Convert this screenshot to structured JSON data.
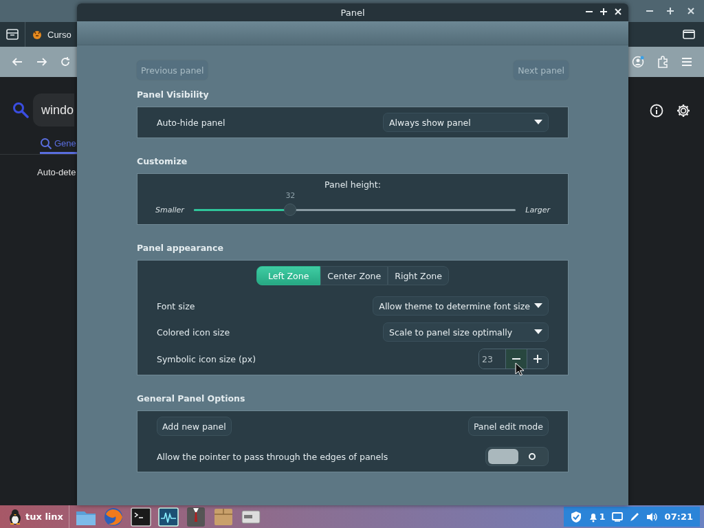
{
  "browser": {
    "tab_label": "Curso",
    "search": {
      "value": "windo"
    },
    "tabs": [
      {
        "label": "Gene",
        "selected": true
      }
    ],
    "setting_label": "Auto-dete"
  },
  "dialog": {
    "title": "Panel",
    "nav": [
      {
        "label": "Previous panel",
        "disabled": true
      },
      {
        "label": "Next panel",
        "disabled": true
      }
    ],
    "sections": [
      {
        "title": "Panel Visibility",
        "rows": [
          {
            "kind": "dropdown",
            "label": "Auto-hide panel",
            "value": "Always show panel"
          }
        ]
      },
      {
        "title": "Customize",
        "rows": [
          {
            "kind": "slider",
            "label": "Panel height:",
            "min_label": "Smaller",
            "max_label": "Larger",
            "reading": "32",
            "level": 0.3
          }
        ]
      },
      {
        "title": "Panel appearance",
        "rows": [
          {
            "kind": "zones",
            "zones": [
              {
                "label": "Left Zone",
                "selected": true
              },
              {
                "label": "Center Zone",
                "selected": false
              },
              {
                "label": "Right Zone",
                "selected": false
              }
            ]
          },
          {
            "kind": "dropdown",
            "label": "Font size",
            "value": "Allow theme to determine font size"
          },
          {
            "kind": "dropdown",
            "label": "Colored icon size",
            "value": "Scale to panel size optimally"
          },
          {
            "kind": "spin",
            "label": "Symbolic icon size (px)",
            "value": "23"
          }
        ]
      },
      {
        "title": "General Panel Options",
        "rows": [
          {
            "kind": "buttons",
            "buttons": [
              "Add new panel",
              "Panel edit mode"
            ]
          },
          {
            "kind": "toggle",
            "label": "Allow the pointer to pass through the edges of panels",
            "on": false
          }
        ]
      }
    ]
  },
  "taskbar": {
    "start_label": "tux linx",
    "notification_count": "1",
    "clock": "07:21"
  }
}
